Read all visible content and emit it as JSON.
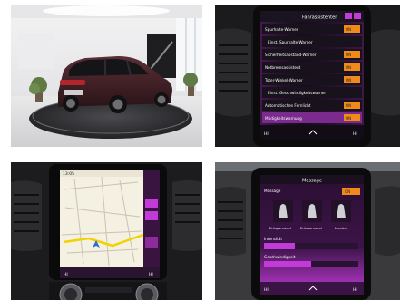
{
  "tile_settings_list": {
    "header_title": "Fahrassistenten",
    "rows": [
      {
        "label": "Spurhalte-Warner",
        "state": "ON"
      },
      {
        "label": "Einst. Spurhalte-Warner",
        "state": ""
      },
      {
        "label": "Sicherheitsabstand-Warner",
        "state": "ON"
      },
      {
        "label": "Notbremsassistent",
        "state": "ON"
      },
      {
        "label": "Toter-Winkel-Warner",
        "state": "ON"
      },
      {
        "label": "Einst. Geschwindigkeitswarner",
        "state": ""
      },
      {
        "label": "Automatisches Fernlicht",
        "state": "ON"
      },
      {
        "label": "Müdigkeitswarnung",
        "state": "ON"
      }
    ],
    "off_label": "OFF",
    "bottom_left": "HI",
    "bottom_right": "HI"
  },
  "tile_navigation": {
    "time": "13:05",
    "bottom_left": "HI",
    "bottom_right": "HI",
    "route_color": "#f2d300",
    "side_accent": "#c03ad6"
  },
  "tile_massage": {
    "header_title": "Massage",
    "toggle_on": "ON",
    "programs": [
      "Entspannend",
      "Entspannend",
      "Lenden"
    ],
    "intensity_label": "Intensität",
    "speed_label": "Geschwindigkeit",
    "bottom_left": "HI",
    "bottom_right": "HI"
  },
  "colors": {
    "accent_magenta": "#c23ad8",
    "accent_orange": "#f08a1a",
    "car_body": "#3a1e22"
  }
}
